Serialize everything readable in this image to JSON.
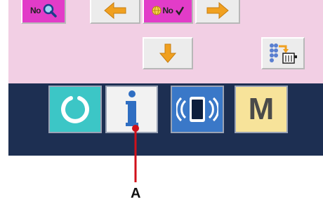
{
  "top_keys": {
    "number_search": {
      "icon": "number-search-icon",
      "text": "No"
    },
    "left_arrow": {
      "icon": "arrow-left-icon",
      "color": "#f0a020"
    },
    "number_key": {
      "icon": "number-icon",
      "text": "No"
    },
    "right_arrow": {
      "icon": "arrow-right-icon",
      "color": "#f0a020"
    },
    "down_arrow": {
      "icon": "arrow-down-icon",
      "color": "#f0a020"
    },
    "data_transfer": {
      "icon": "data-transfer-icon"
    }
  },
  "nav_bar": {
    "background": "#1d2f52",
    "keys": [
      {
        "name": "reset",
        "icon": "circle-reset-icon",
        "color": "#3cc6c6"
      },
      {
        "name": "information",
        "icon": "info-icon",
        "color": "#f2f2f2"
      },
      {
        "name": "communication",
        "icon": "communication-icon",
        "color": "#3a78c8"
      },
      {
        "name": "mode",
        "label": "M",
        "color": "#f7e39a"
      }
    ]
  },
  "callout": {
    "label": "A",
    "color": "#d0101a"
  },
  "colors": {
    "panel_pink": "#f2cfe4",
    "accent_orange": "#f0a020",
    "magenta_key": "#e23cc8"
  }
}
